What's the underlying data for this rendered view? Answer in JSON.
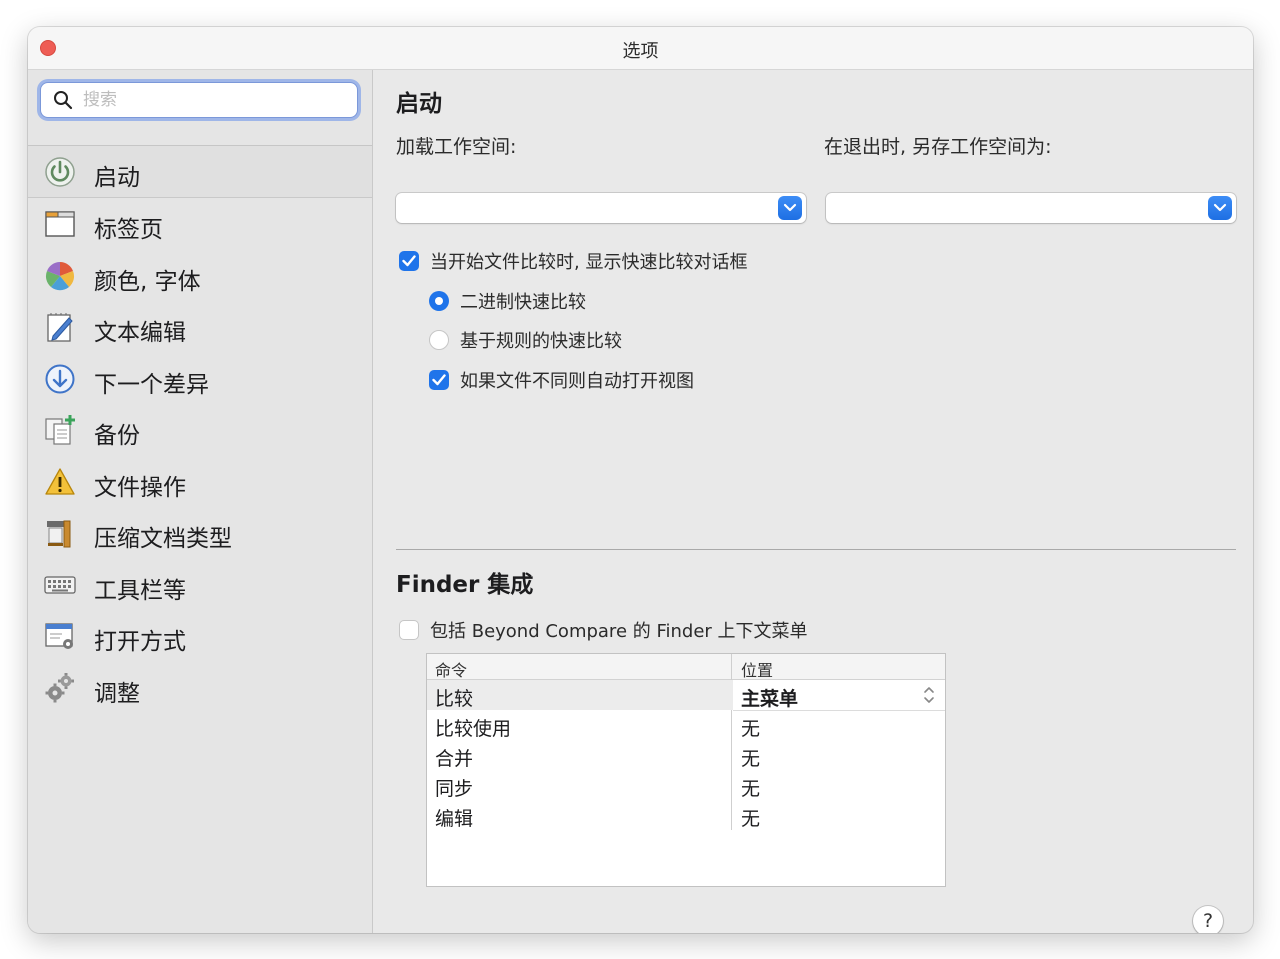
{
  "window": {
    "title": "选项"
  },
  "search": {
    "placeholder": "搜索",
    "value": ""
  },
  "sidebar": {
    "items": [
      {
        "label": "启动",
        "icon": "power-icon",
        "selected": true
      },
      {
        "label": "标签页",
        "icon": "tabs-icon"
      },
      {
        "label": "颜色, 字体",
        "icon": "color-wheel-icon"
      },
      {
        "label": "文本编辑",
        "icon": "pencil-notepad-icon"
      },
      {
        "label": "下一个差异",
        "icon": "down-arrow-circle-icon"
      },
      {
        "label": "备份",
        "icon": "backup-documents-icon"
      },
      {
        "label": "文件操作",
        "icon": "warning-icon"
      },
      {
        "label": "压缩文档类型",
        "icon": "archive-clamp-icon"
      },
      {
        "label": "工具栏等",
        "icon": "keyboard-icon"
      },
      {
        "label": "打开方式",
        "icon": "open-with-icon"
      },
      {
        "label": "调整",
        "icon": "gears-icon"
      }
    ]
  },
  "startup": {
    "title": "启动",
    "load_workspace_label": "加载工作空间:",
    "save_workspace_label": "在退出时, 另存工作空间为:",
    "load_workspace_value": "",
    "save_workspace_value": "",
    "show_quick_compare": {
      "label": "当开始文件比较时, 显示快速比较对话框",
      "checked": true
    },
    "binary_quick_compare": {
      "label": "二进制快速比较",
      "selected": true
    },
    "rules_quick_compare": {
      "label": "基于规则的快速比较",
      "selected": false
    },
    "auto_open_view": {
      "label": "如果文件不同则自动打开视图",
      "checked": true
    }
  },
  "finder": {
    "title": "Finder 集成",
    "include_menu": {
      "label": "包括 Beyond Compare 的 Finder 上下文菜单",
      "checked": false
    },
    "table": {
      "headers": [
        "命令",
        "位置"
      ],
      "rows": [
        {
          "command": "比较",
          "location": "主菜单",
          "selected": true
        },
        {
          "command": "比较使用",
          "location": "无"
        },
        {
          "command": "合并",
          "location": "无"
        },
        {
          "command": "同步",
          "location": "无"
        },
        {
          "command": "编辑",
          "location": "无"
        }
      ]
    }
  },
  "help": {
    "label": "?"
  },
  "colors": {
    "accent": "#1f74ea",
    "close": "#ee5d55"
  }
}
